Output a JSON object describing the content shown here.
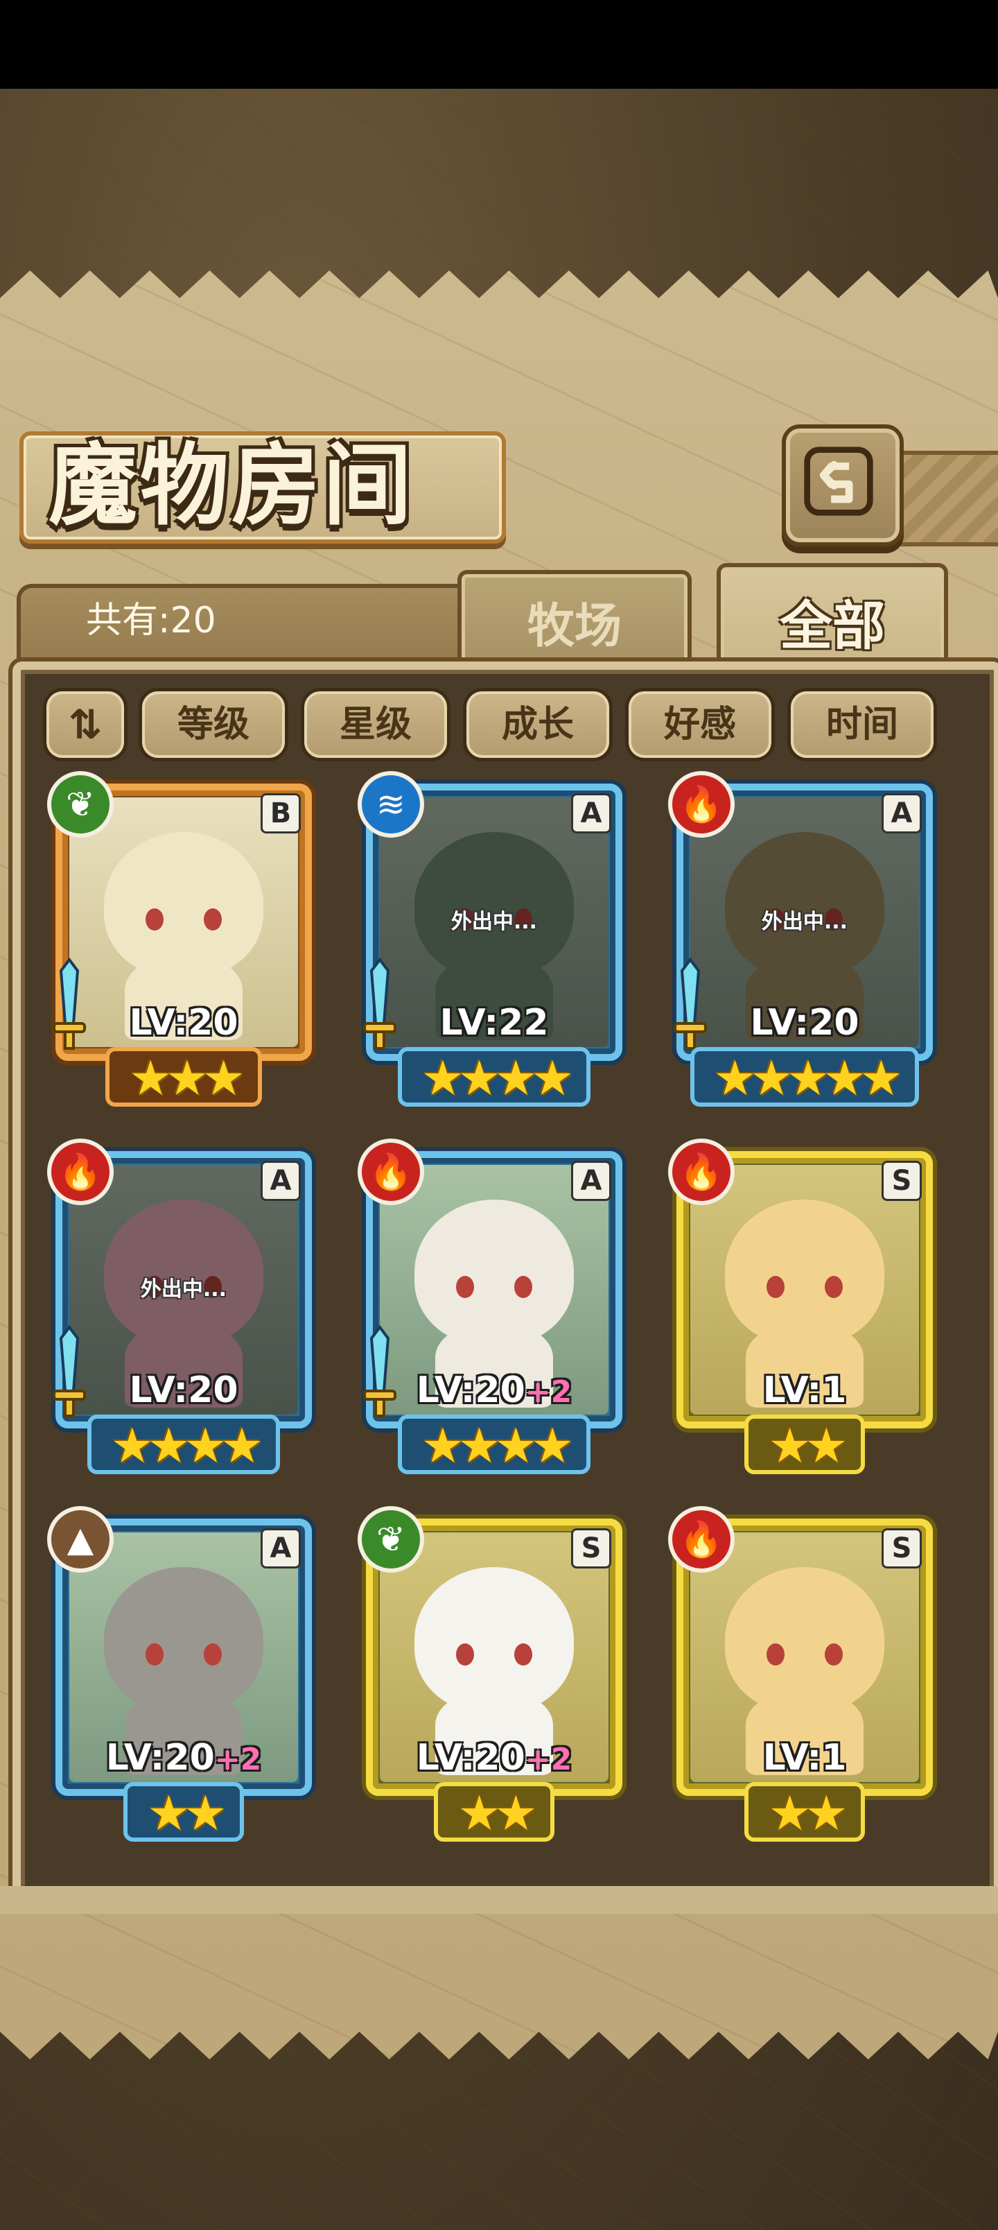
{
  "header": {
    "title": "魔物房间",
    "back_icon": "return-arrow-icon"
  },
  "tabs": [
    {
      "label": "牧场",
      "selected": false
    },
    {
      "label": "全部",
      "selected": true
    }
  ],
  "count_text": "共有:20",
  "sort_buttons": {
    "order_label": "⇅",
    "items": [
      "等级",
      "星级",
      "成长",
      "好感",
      "时间"
    ]
  },
  "monsters": [
    {
      "grade": "B",
      "element": "wood",
      "element_icon": "leaf-icon",
      "level": "LV:20",
      "bonus": "",
      "stars": "★★★",
      "away": "",
      "has_weapon": true
    },
    {
      "grade": "A",
      "element": "water",
      "element_icon": "water-wave-icon",
      "level": "LV:22",
      "bonus": "",
      "stars": "★★★★",
      "away": "外出中...",
      "has_weapon": true
    },
    {
      "grade": "A",
      "element": "fire",
      "element_icon": "flame-icon",
      "level": "LV:20",
      "bonus": "",
      "stars": "★★★★★",
      "away": "外出中...",
      "has_weapon": true
    },
    {
      "grade": "A",
      "element": "fire",
      "element_icon": "flame-icon",
      "level": "LV:20",
      "bonus": "",
      "stars": "★★★★",
      "away": "外出中...",
      "has_weapon": true
    },
    {
      "grade": "A",
      "element": "fire",
      "element_icon": "flame-icon",
      "level": "LV:20",
      "bonus": "+2",
      "stars": "★★★★",
      "away": "",
      "has_weapon": true
    },
    {
      "grade": "S",
      "element": "fire",
      "element_icon": "flame-icon",
      "level": "LV:1",
      "bonus": "",
      "stars": "★★",
      "away": "",
      "has_weapon": false
    },
    {
      "grade": "A",
      "element": "earth",
      "element_icon": "mountain-icon",
      "level": "LV:20",
      "bonus": "+2",
      "stars": "★★",
      "away": "",
      "has_weapon": false
    },
    {
      "grade": "S",
      "element": "wood",
      "element_icon": "leaf-icon",
      "level": "LV:20",
      "bonus": "+2",
      "stars": "★★",
      "away": "",
      "has_weapon": false
    },
    {
      "grade": "S",
      "element": "fire",
      "element_icon": "flame-icon",
      "level": "LV:1",
      "bonus": "",
      "stars": "★★",
      "away": "",
      "has_weapon": false
    }
  ],
  "colors": {
    "rank_a": "#6ec3ec",
    "rank_s": "#f5dc42",
    "rank_b": "#f0a64a",
    "fire": "#c9231f",
    "water": "#1c76c7",
    "wood": "#3b8a2a",
    "earth": "#7a5432",
    "bonus_pink": "#ff6fb1"
  }
}
